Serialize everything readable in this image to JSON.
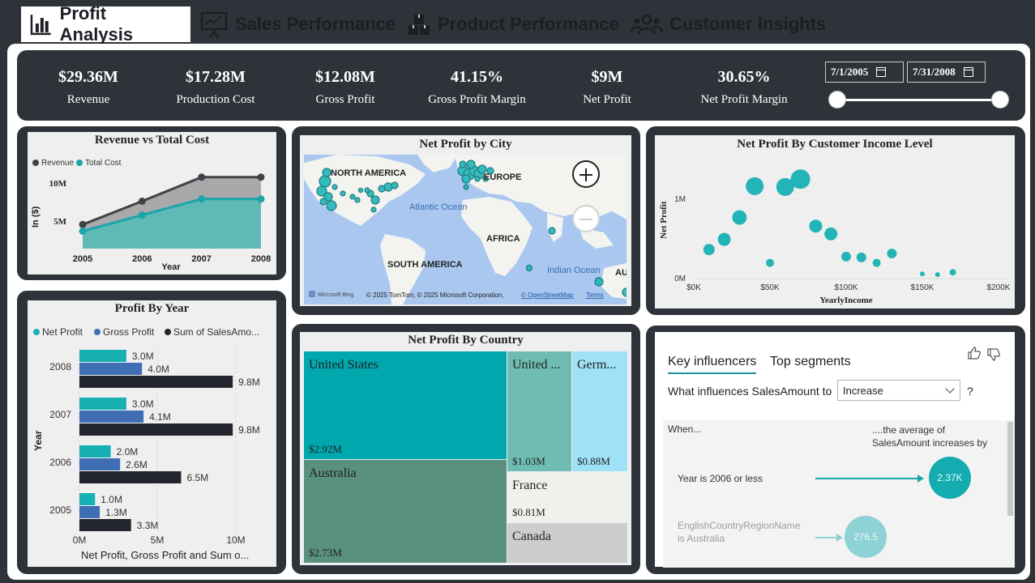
{
  "tabs": [
    {
      "label": "Profit Analysis",
      "icon": "bar-chart-icon",
      "active": true
    },
    {
      "label": "Sales Performance",
      "icon": "presentation-board-icon",
      "active": false
    },
    {
      "label": "Product Performance",
      "icon": "boxes-icon",
      "active": false
    },
    {
      "label": "Customer Insights",
      "icon": "people-group-icon",
      "active": false
    }
  ],
  "kpis": [
    {
      "value": "$29.36M",
      "label": "Revenue"
    },
    {
      "value": "$17.28M",
      "label": "Production Cost"
    },
    {
      "value": "$12.08M",
      "label": "Gross Profit"
    },
    {
      "value": "41.15%",
      "label": "Gross Profit Margin"
    },
    {
      "value": "$9M",
      "label": "Net Profit"
    },
    {
      "value": "30.65%",
      "label": "Net Profit Margin"
    }
  ],
  "date_filter": {
    "start": "7/1/2005",
    "end": "7/31/2008"
  },
  "revenue_vs_cost": {
    "title": "Revenue vs Total Cost",
    "legend": [
      "Revenue",
      "Total Cost"
    ],
    "ylabel": "In ($)",
    "xlabel": "Year",
    "yticks": [
      "10M",
      "5M"
    ],
    "colors": {
      "revenue": "#3f4247",
      "cost": "#1aa6a8"
    }
  },
  "profit_by_year": {
    "title": "Profit By Year",
    "legend": [
      "Net Profit",
      "Gross Profit",
      "Sum of SalesAmo..."
    ],
    "ylabel": "Year",
    "xlabel": "Net Profit, Gross Profit and Sum o...",
    "xticks": [
      "0M",
      "5M",
      "10M"
    ],
    "colors": {
      "net": "#17b0b3",
      "gross": "#3f6eb5",
      "sales": "#22252b"
    },
    "value_labels": [
      [
        "3.0M",
        "4.0M",
        "9.8M"
      ],
      [
        "3.0M",
        "4.1M",
        "9.8M"
      ],
      [
        "2.0M",
        "2.6M",
        "6.5M"
      ],
      [
        "1.0M",
        "1.3M",
        "3.3M"
      ]
    ]
  },
  "map": {
    "title": "Net Profit by City",
    "labels": {
      "na": "NORTH AMERICA",
      "eu": "EUROPE",
      "af": "AFRICA",
      "sa": "SOUTH AMERICA",
      "atl": "Atlantic Ocean",
      "ind": "Indian Ocean",
      "au": "AU"
    },
    "attribution": "© 2025 TomTom, © 2025 Microsoft Corporation,",
    "osm": "© OpenStreetMap",
    "terms": "Terms",
    "bing": "Microsoft Bing"
  },
  "scatter": {
    "title": "Net Profit By Customer Income Level",
    "xlabel": "YearlyIncome",
    "ylabel": "Net Profit",
    "xticks": [
      "$0K",
      "$50K",
      "$100K",
      "$150K",
      "$200K"
    ],
    "yticks": [
      "1M",
      "0M"
    ]
  },
  "treemap": {
    "title": "Net Profit By Country",
    "tiles": [
      {
        "name": "United States",
        "value": "$2.92M"
      },
      {
        "name": "Australia",
        "value": "$2.73M"
      },
      {
        "name": "United ...",
        "value": "$1.03M"
      },
      {
        "name": "Germ...",
        "value": "$0.88M"
      },
      {
        "name": "France",
        "value": "$0.81M"
      },
      {
        "name": "Canada",
        "value": ""
      }
    ]
  },
  "key_influencers": {
    "tabs": [
      "Key influencers",
      "Top segments"
    ],
    "question": "What influences SalesAmount to",
    "selected": "Increase",
    "question_mark": "?",
    "when": "When...",
    "avg_text": "....the average of SalesAmount increases by",
    "rows": [
      {
        "label": "Year is 2006 or less",
        "value": "2.37K"
      },
      {
        "label": "EnglishCountryRegionName is Australia",
        "value": "276.5"
      }
    ]
  },
  "chart_data": [
    {
      "type": "area",
      "title": "Revenue vs Total Cost",
      "xlabel": "Year",
      "ylabel": "In ($)",
      "categories": [
        "2005",
        "2006",
        "2007",
        "2008"
      ],
      "series": [
        {
          "name": "Revenue",
          "values": [
            3.3,
            6.5,
            9.8,
            9.8
          ]
        },
        {
          "name": "Total Cost",
          "values": [
            2.4,
            4.6,
            6.8,
            6.8
          ]
        }
      ],
      "ylim": [
        0,
        10
      ],
      "yticks_label": [
        "10M",
        "5M"
      ]
    },
    {
      "type": "bar",
      "title": "Profit By Year",
      "ylabel": "Year",
      "xlabel": "Net Profit, Gross Profit and Sum o...",
      "categories": [
        "2008",
        "2007",
        "2006",
        "2005"
      ],
      "series": [
        {
          "name": "Net Profit",
          "values": [
            3.0,
            3.0,
            2.0,
            1.0
          ]
        },
        {
          "name": "Gross Profit",
          "values": [
            4.0,
            4.1,
            2.6,
            1.3
          ]
        },
        {
          "name": "Sum of SalesAmo...",
          "values": [
            9.8,
            9.8,
            6.5,
            3.3
          ]
        }
      ],
      "xlim": [
        0,
        11
      ]
    },
    {
      "type": "scatter",
      "title": "Net Profit By Customer Income Level",
      "xlabel": "YearlyIncome",
      "ylabel": "Net Profit",
      "xlim": [
        0,
        200
      ],
      "ylim": [
        0,
        1.5
      ],
      "points": [
        {
          "x": 10,
          "y": 0.37,
          "r": 7
        },
        {
          "x": 20,
          "y": 0.5,
          "r": 8
        },
        {
          "x": 30,
          "y": 0.78,
          "r": 9
        },
        {
          "x": 40,
          "y": 1.18,
          "r": 11
        },
        {
          "x": 50,
          "y": 0.2,
          "r": 5
        },
        {
          "x": 60,
          "y": 1.17,
          "r": 11
        },
        {
          "x": 70,
          "y": 1.27,
          "r": 12
        },
        {
          "x": 80,
          "y": 0.67,
          "r": 8
        },
        {
          "x": 90,
          "y": 0.57,
          "r": 8
        },
        {
          "x": 100,
          "y": 0.28,
          "r": 6
        },
        {
          "x": 110,
          "y": 0.27,
          "r": 6
        },
        {
          "x": 120,
          "y": 0.2,
          "r": 5
        },
        {
          "x": 130,
          "y": 0.32,
          "r": 6
        },
        {
          "x": 150,
          "y": 0.06,
          "r": 3
        },
        {
          "x": 160,
          "y": 0.05,
          "r": 3
        },
        {
          "x": 170,
          "y": 0.08,
          "r": 4
        }
      ]
    },
    {
      "type": "table",
      "title": "Net Profit By Country",
      "categories": [
        "United States",
        "Australia",
        "United ...",
        "Germ...",
        "France",
        "Canada"
      ],
      "values": [
        2.92,
        2.73,
        1.03,
        0.88,
        0.81,
        null
      ]
    }
  ]
}
